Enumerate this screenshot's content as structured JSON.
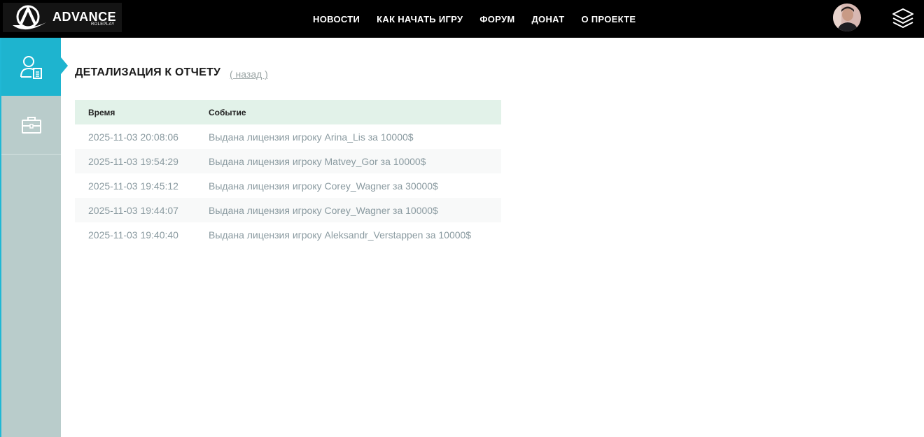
{
  "header": {
    "logo_text": "ADVANCE",
    "logo_sub": "ROLEPLAY",
    "nav": [
      "НОВОСТИ",
      "КАК НАЧАТЬ ИГРУ",
      "ФОРУМ",
      "ДОНАТ",
      "О ПРОЕКТЕ"
    ]
  },
  "sidebar": {
    "items": [
      {
        "icon": "user-report-icon",
        "active": true
      },
      {
        "icon": "briefcase-icon",
        "active": false
      }
    ]
  },
  "main": {
    "title": "ДЕТАЛИЗАЦИЯ К ОТЧЕТУ",
    "back_label": "( назад )",
    "table": {
      "columns": [
        "Время",
        "Событие"
      ],
      "rows": [
        {
          "time": "2025-11-03 20:08:06",
          "event": "Выдана лицензия игроку Arina_Lis за 10000$"
        },
        {
          "time": "2025-11-03 19:54:29",
          "event": "Выдана лицензия игроку Matvey_Gor за 10000$"
        },
        {
          "time": "2025-11-03 19:45:12",
          "event": "Выдана лицензия игроку Corey_Wagner за 30000$"
        },
        {
          "time": "2025-11-03 19:44:07",
          "event": "Выдана лицензия игроку Corey_Wagner за 10000$"
        },
        {
          "time": "2025-11-03 19:40:40",
          "event": "Выдана лицензия игроку Aleksandr_Verstappen за 10000$"
        }
      ]
    }
  },
  "colors": {
    "accent": "#1eb4cf",
    "sidebar_bg": "#b9cccb",
    "header_bg": "#000000",
    "table_header_bg": "#e2f2e9"
  }
}
